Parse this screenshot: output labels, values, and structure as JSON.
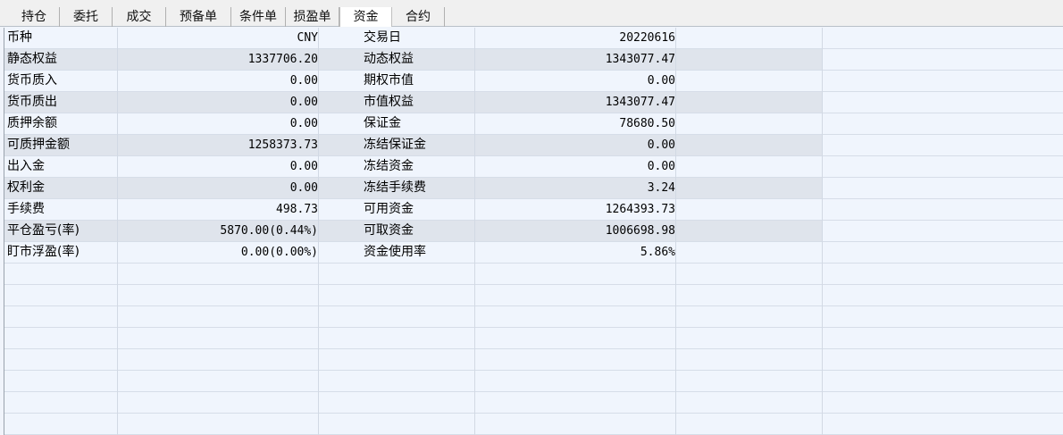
{
  "tabs": [
    "持仓",
    "委托",
    "成交",
    "预备单",
    "条件单",
    "损盈单",
    "资金",
    "合约"
  ],
  "active_tab_index": 6,
  "rows": [
    {
      "l1": "币种",
      "v1": "CNY",
      "l2": "交易日",
      "v2": "20220616"
    },
    {
      "l1": "静态权益",
      "v1": "1337706.20",
      "l2": "动态权益",
      "v2": "1343077.47"
    },
    {
      "l1": "货币质入",
      "v1": "0.00",
      "l2": "期权市值",
      "v2": "0.00"
    },
    {
      "l1": "货币质出",
      "v1": "0.00",
      "l2": "市值权益",
      "v2": "1343077.47"
    },
    {
      "l1": "质押余额",
      "v1": "0.00",
      "l2": "保证金",
      "v2": "78680.50"
    },
    {
      "l1": "可质押金额",
      "v1": "1258373.73",
      "l2": "冻结保证金",
      "v2": "0.00"
    },
    {
      "l1": "出入金",
      "v1": "0.00",
      "l2": "冻结资金",
      "v2": "0.00"
    },
    {
      "l1": "权利金",
      "v1": "0.00",
      "l2": "冻结手续费",
      "v2": "3.24"
    },
    {
      "l1": "手续费",
      "v1": "498.73",
      "l2": "可用资金",
      "v2": "1264393.73"
    },
    {
      "l1": "平仓盈亏(率)",
      "v1": "5870.00(0.44%)",
      "l2": "可取资金",
      "v2": "1006698.98"
    },
    {
      "l1": "盯市浮盈(率)",
      "v1": "0.00(0.00%)",
      "l2": "资金使用率",
      "v2": "5.86%"
    }
  ],
  "empty_rows": 8,
  "colors": {
    "row_alt": "#dfe4ec",
    "row_base": "#f0f5fd",
    "grid_line": "#d2d9e4"
  }
}
